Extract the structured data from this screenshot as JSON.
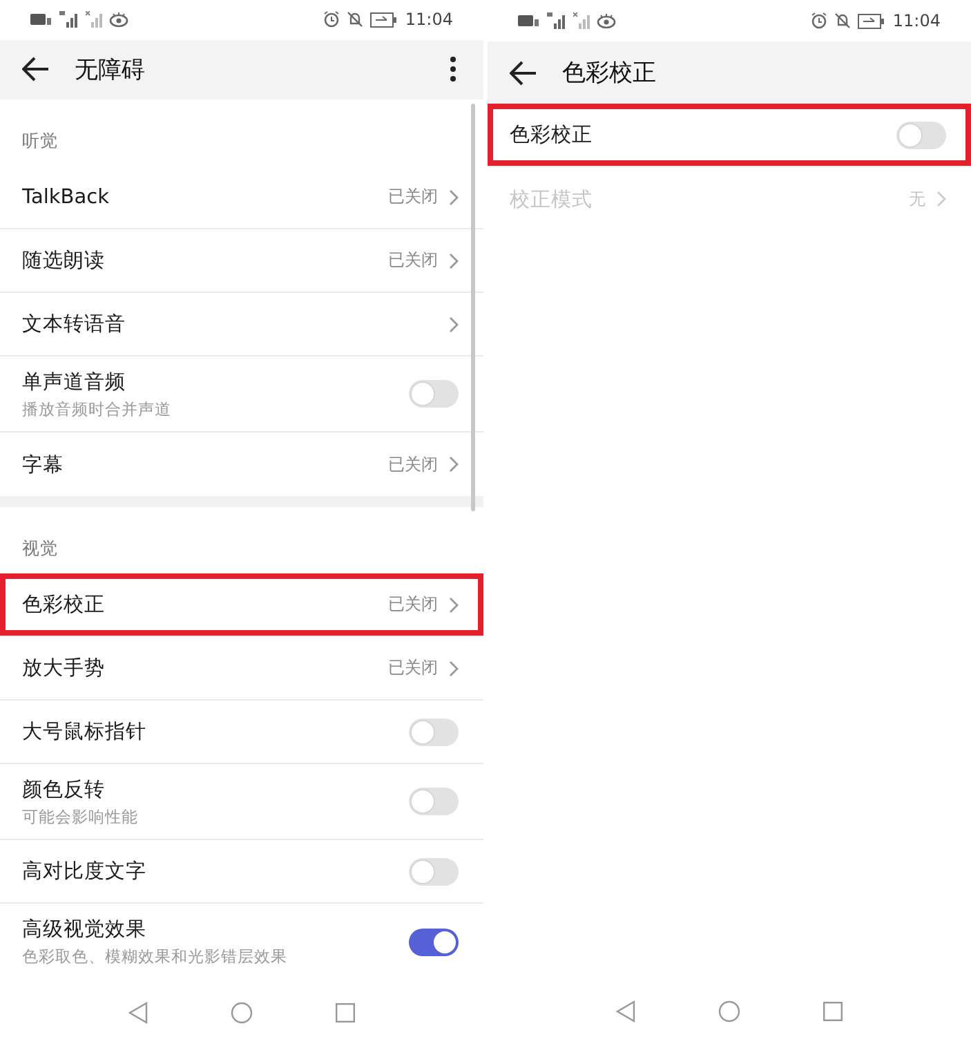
{
  "screens": [
    {
      "status_bar": {
        "time": "11:04"
      },
      "header": {
        "title": "无障碍",
        "has_menu": true
      },
      "scrollbar": true,
      "sections": [
        {
          "title": "听觉",
          "items": [
            {
              "kind": "link",
              "label": "TalkBack",
              "value": "已关闭",
              "highlighted": false,
              "disabled": false
            },
            {
              "kind": "link",
              "label": "随选朗读",
              "value": "已关闭",
              "highlighted": false,
              "disabled": false
            },
            {
              "kind": "link",
              "label": "文本转语音",
              "highlighted": false,
              "disabled": false
            },
            {
              "kind": "toggle",
              "label": "单声道音频",
              "subtitle": "播放音频时合并声道",
              "on": false,
              "highlighted": false,
              "disabled": false
            },
            {
              "kind": "link",
              "label": "字幕",
              "value": "已关闭",
              "highlighted": false,
              "disabled": false
            }
          ]
        },
        {
          "title": "视觉",
          "items": [
            {
              "kind": "link",
              "label": "色彩校正",
              "value": "已关闭",
              "highlighted": true,
              "disabled": false
            },
            {
              "kind": "link",
              "label": "放大手势",
              "value": "已关闭",
              "highlighted": false,
              "disabled": false
            },
            {
              "kind": "toggle",
              "label": "大号鼠标指针",
              "on": false,
              "highlighted": false,
              "disabled": false
            },
            {
              "kind": "toggle",
              "label": "颜色反转",
              "subtitle": "可能会影响性能",
              "on": false,
              "highlighted": false,
              "disabled": false
            },
            {
              "kind": "toggle",
              "label": "高对比度文字",
              "on": false,
              "highlighted": false,
              "disabled": false
            },
            {
              "kind": "toggle",
              "label": "高级视觉效果",
              "subtitle": "色彩取色、模糊效果和光影错层效果",
              "on": true,
              "highlighted": false,
              "disabled": false
            }
          ]
        }
      ]
    },
    {
      "status_bar": {
        "time": "11:04"
      },
      "header": {
        "title": "色彩校正",
        "has_menu": false
      },
      "scrollbar": false,
      "sections": [
        {
          "items": [
            {
              "kind": "toggle",
              "label": "色彩校正",
              "on": false,
              "highlighted": true,
              "disabled": false
            },
            {
              "kind": "link",
              "label": "校正模式",
              "value": "无",
              "highlighted": false,
              "disabled": true
            }
          ]
        }
      ]
    }
  ]
}
